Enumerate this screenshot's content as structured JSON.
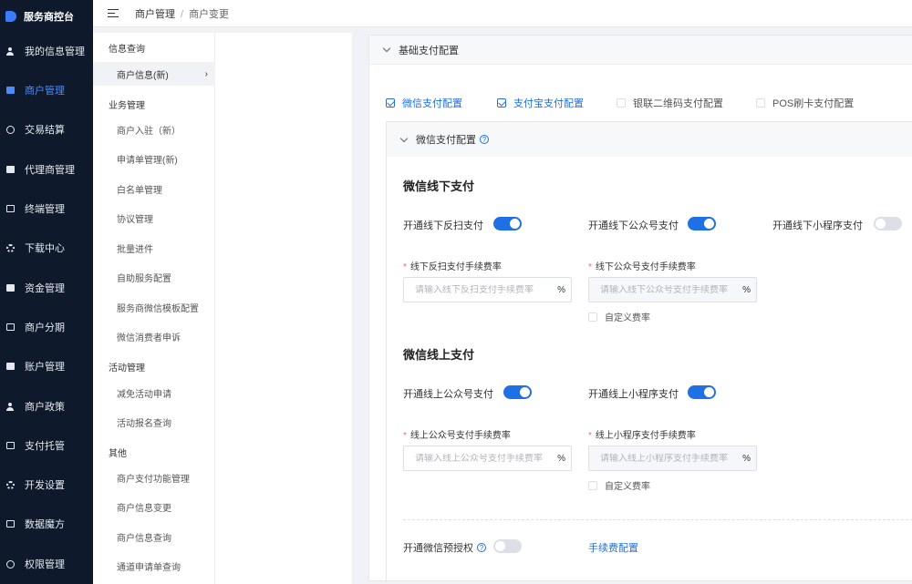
{
  "brand": {
    "title": "服务商控台"
  },
  "colors": {
    "sidebar_bg": "#0e1a2b",
    "accent": "#1f6fe5",
    "required": "#f56c6c"
  },
  "sidebar": {
    "items": [
      {
        "label": "我的信息管理",
        "icon": "user-icon"
      },
      {
        "label": "商户管理",
        "icon": "store-icon",
        "active": true
      },
      {
        "label": "交易结算",
        "icon": "yen-icon"
      },
      {
        "label": "代理商管理",
        "icon": "agent-icon"
      },
      {
        "label": "终端管理",
        "icon": "terminal-icon"
      },
      {
        "label": "下载中心",
        "icon": "gear-icon"
      },
      {
        "label": "资金管理",
        "icon": "wallet-icon"
      },
      {
        "label": "商户分期",
        "icon": "calendar-icon"
      },
      {
        "label": "账户管理",
        "icon": "card-icon"
      },
      {
        "label": "商户政策",
        "icon": "user-icon"
      },
      {
        "label": "支付托管",
        "icon": "doc-icon"
      },
      {
        "label": "开发设置",
        "icon": "gear-icon"
      },
      {
        "label": "数据魔方",
        "icon": "calendar-icon"
      },
      {
        "label": "权限管理",
        "icon": "shield-icon"
      }
    ]
  },
  "header": {
    "breadcrumb": [
      "商户管理",
      "商户变更"
    ]
  },
  "subnav": {
    "groups": [
      {
        "title": "信息查询",
        "items": [
          {
            "label": "商户信息(新)",
            "active": true
          }
        ]
      },
      {
        "title": "业务管理",
        "items": [
          {
            "label": "商户入驻（新）"
          },
          {
            "label": "申请单管理(新)"
          },
          {
            "label": "白名单管理"
          },
          {
            "label": "协议管理"
          },
          {
            "label": "批量进件"
          },
          {
            "label": "自助服务配置"
          },
          {
            "label": "服务商微信模板配置"
          },
          {
            "label": "微信消费者申诉"
          }
        ]
      },
      {
        "title": "活动管理",
        "items": [
          {
            "label": "减免活动申请"
          },
          {
            "label": "活动报名查询"
          }
        ]
      },
      {
        "title": "其他",
        "items": [
          {
            "label": "商户支付功能管理"
          },
          {
            "label": "商户信息变更"
          },
          {
            "label": "商户信息查询"
          },
          {
            "label": "通道申请单查询"
          }
        ]
      }
    ]
  },
  "main": {
    "card_title": "基础支付配置",
    "pay_types": [
      {
        "label": "微信支付配置",
        "checked": true
      },
      {
        "label": "支付宝支付配置",
        "checked": true
      },
      {
        "label": "银联二维码支付配置",
        "checked": false
      },
      {
        "label": "POS刷卡支付配置",
        "checked": false
      }
    ],
    "wechat": {
      "panel_title": "微信支付配置",
      "offline": {
        "title": "微信线下支付",
        "toggles": [
          {
            "label": "开通线下反扫支付",
            "on": true
          },
          {
            "label": "开通线下公众号支付",
            "on": true
          },
          {
            "label": "开通线下小程序支付",
            "on": false
          }
        ],
        "fields": [
          {
            "label": "线下反扫支付手续费率",
            "placeholder": "请输入线下反扫支付手续费率",
            "unit": "%"
          },
          {
            "label": "线下公众号支付手续费率",
            "placeholder": "请输入线下公众号支付手续费率",
            "unit": "%"
          }
        ],
        "custom_rate": "自定义费率"
      },
      "online": {
        "title": "微信线上支付",
        "toggles": [
          {
            "label": "开通线上公众号支付",
            "on": true
          },
          {
            "label": "开通线上小程序支付",
            "on": true
          }
        ],
        "fields": [
          {
            "label": "线上公众号支付手续费率",
            "placeholder": "请输入线上公众号支付手续费率",
            "unit": "%"
          },
          {
            "label": "线上小程序支付手续费率",
            "placeholder": "请输入线上小程序支付手续费率",
            "unit": "%"
          }
        ],
        "custom_rate": "自定义费率"
      },
      "preauth_label": "开通微信预授权",
      "preauth_on": false,
      "fee_link": "手续费配置"
    }
  }
}
